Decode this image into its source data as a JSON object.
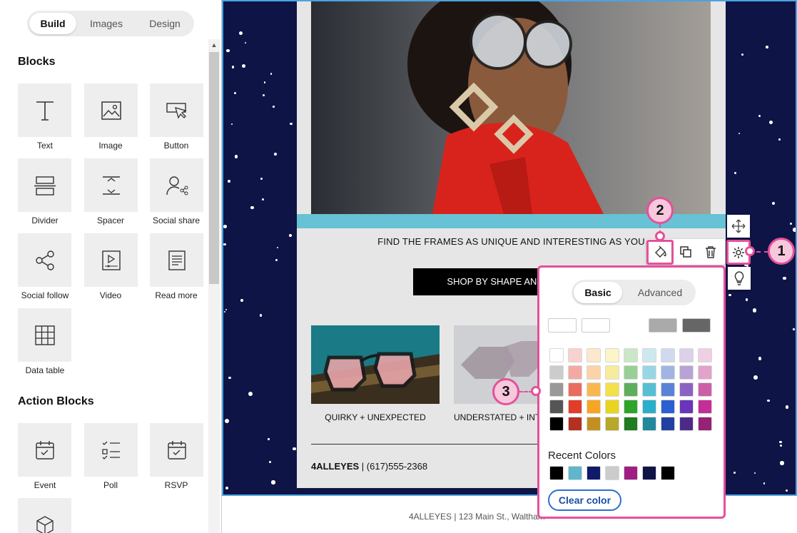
{
  "sidebar": {
    "tabs": [
      {
        "label": "Build"
      },
      {
        "label": "Images"
      },
      {
        "label": "Design"
      }
    ],
    "blocks_title": "Blocks",
    "blocks": [
      {
        "label": "Text",
        "icon": "text-icon"
      },
      {
        "label": "Image",
        "icon": "image-icon"
      },
      {
        "label": "Button",
        "icon": "button-cursor-icon"
      },
      {
        "label": "Divider",
        "icon": "divider-icon"
      },
      {
        "label": "Spacer",
        "icon": "spacer-icon"
      },
      {
        "label": "Social share",
        "icon": "social-share-icon"
      },
      {
        "label": "Social follow",
        "icon": "share-nodes-icon"
      },
      {
        "label": "Video",
        "icon": "video-icon"
      },
      {
        "label": "Read more",
        "icon": "document-icon"
      },
      {
        "label": "Data table",
        "icon": "table-icon"
      }
    ],
    "action_title": "Action Blocks",
    "action_blocks": [
      {
        "label": "Event",
        "icon": "calendar-check-icon"
      },
      {
        "label": "Poll",
        "icon": "checklist-icon"
      },
      {
        "label": "RSVP",
        "icon": "calendar-check-icon"
      }
    ]
  },
  "email": {
    "tagline": "FIND THE FRAMES AS UNIQUE AND INTERESTING AS YOU",
    "shop_button": "SHOP BY SHAPE AND STYLE",
    "products": [
      {
        "caption": "QUIRKY + UNEXPECTED"
      },
      {
        "caption": "UNDERSTATED + INTENTIONAL"
      }
    ],
    "brand": "4ALLEYES",
    "phone": " | (617)555-2368",
    "footer": "4ALLEYES | 123 Main St., Waltham"
  },
  "callouts": [
    "1",
    "2",
    "3"
  ],
  "picker": {
    "tabs": [
      {
        "label": "Basic"
      },
      {
        "label": "Advanced"
      }
    ],
    "recent_title": "Recent Colors",
    "clear_label": "Clear color",
    "theme_swatches": [
      "#ffffff",
      "#ffffff",
      "#ffffff",
      "#aaaaaa",
      "#666666"
    ],
    "grid": [
      [
        "#ffffff",
        "#f8d2cf",
        "#fde7cd",
        "#fbf5c9",
        "#c9e6c6",
        "#cde9f0",
        "#d0d9f0",
        "#dcd0ea",
        "#efcfe4"
      ],
      [
        "#cccccc",
        "#f4a9a2",
        "#fbd3a6",
        "#f7ec9c",
        "#97d094",
        "#99d6e4",
        "#a0b5e3",
        "#b9a2d6",
        "#e1a3c9"
      ],
      [
        "#999999",
        "#ea6c5f",
        "#f8b84e",
        "#f3e04a",
        "#5fae5b",
        "#57bfd3",
        "#5b82d6",
        "#8a63c2",
        "#cc5fa8"
      ],
      [
        "#555555",
        "#e23c2b",
        "#f6a623",
        "#e9d420",
        "#2ea42b",
        "#2baecc",
        "#2c5fd0",
        "#6a35b8",
        "#c42e98"
      ],
      [
        "#000000",
        "#b43021",
        "#c38f23",
        "#b7a72a",
        "#217b20",
        "#23879e",
        "#2140a0",
        "#4e2a88",
        "#962274"
      ]
    ],
    "recent": [
      "#000000",
      "#5fb7cc",
      "#101a6b",
      "#cccccc",
      "#a01e84",
      "#0f1446",
      "#000000"
    ]
  }
}
